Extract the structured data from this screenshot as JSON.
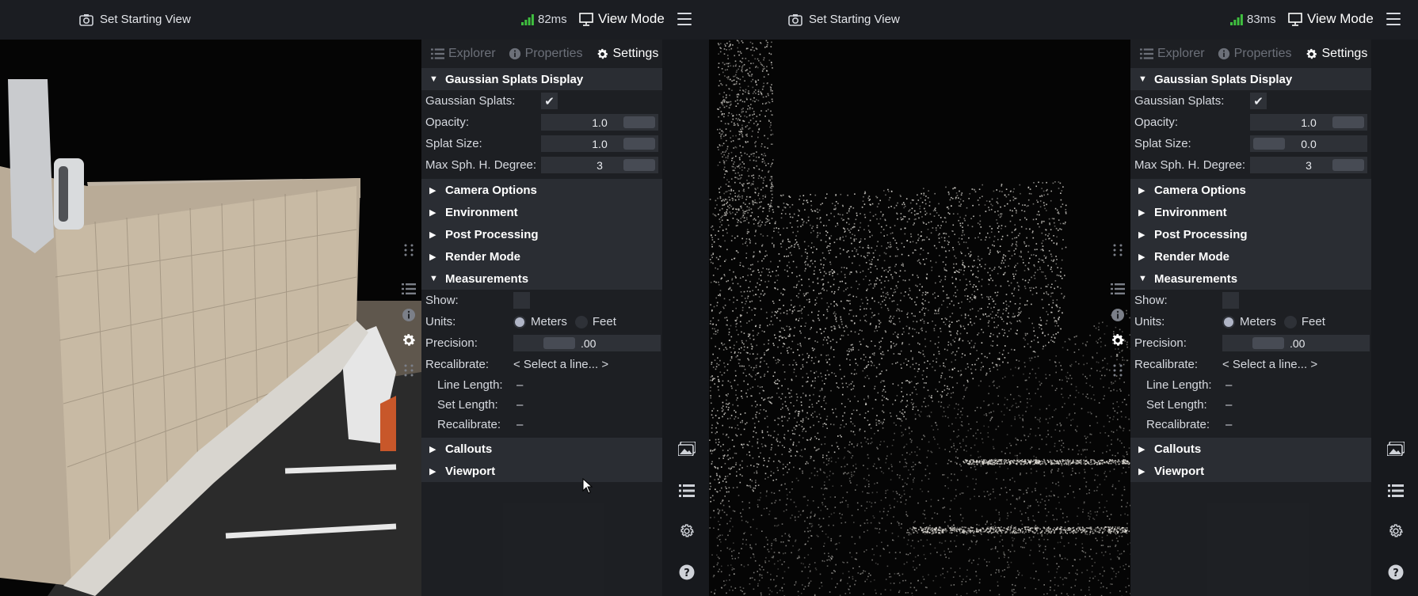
{
  "apps": [
    {
      "topbar": {
        "starting_view_label": "Set Starting View",
        "latency": "82ms",
        "view_mode_label": "View Mode"
      },
      "tabs": [
        {
          "label": "Explorer",
          "icon": "list-icon"
        },
        {
          "label": "Properties",
          "icon": "info-icon"
        },
        {
          "label": "Settings",
          "icon": "gear-icon"
        }
      ],
      "gaussian": {
        "title": "Gaussian Splats Display",
        "splats_label": "Gaussian Splats:",
        "opacity_label": "Opacity:",
        "opacity_value": "1.0",
        "splat_size_label": "Splat Size:",
        "splat_size_value": "1.0",
        "degree_label": "Max Sph. H. Degree:",
        "degree_value": "3"
      },
      "sections_collapsed": [
        "Camera Options",
        "Environment",
        "Post Processing",
        "Render Mode"
      ],
      "measurements": {
        "title": "Measurements",
        "show_label": "Show:",
        "units_label": "Units:",
        "meters": "Meters",
        "feet": "Feet",
        "precision_label": "Precision:",
        "precision_value": ".00",
        "recalibrate_label": "Recalibrate:",
        "recalibrate_value": "< Select a line... >",
        "line_length_label": "Line Length:",
        "line_length_value": "–",
        "set_length_label": "Set Length:",
        "set_length_value": "–",
        "recalibrate2_label": "Recalibrate:",
        "recalibrate2_value": "–"
      },
      "callouts": "Callouts",
      "viewport_section": "Viewport"
    },
    {
      "topbar": {
        "starting_view_label": "Set Starting View",
        "latency": "83ms",
        "view_mode_label": "View Mode"
      },
      "tabs": [
        {
          "label": "Explorer",
          "icon": "list-icon"
        },
        {
          "label": "Properties",
          "icon": "info-icon"
        },
        {
          "label": "Settings",
          "icon": "gear-icon"
        }
      ],
      "gaussian": {
        "title": "Gaussian Splats Display",
        "splats_label": "Gaussian Splats:",
        "opacity_label": "Opacity:",
        "opacity_value": "1.0",
        "splat_size_label": "Splat Size:",
        "splat_size_value": "0.0",
        "degree_label": "Max Sph. H. Degree:",
        "degree_value": "3"
      },
      "sections_collapsed": [
        "Camera Options",
        "Environment",
        "Post Processing",
        "Render Mode"
      ],
      "measurements": {
        "title": "Measurements",
        "show_label": "Show:",
        "units_label": "Units:",
        "meters": "Meters",
        "feet": "Feet",
        "precision_label": "Precision:",
        "precision_value": ".00",
        "recalibrate_label": "Recalibrate:",
        "recalibrate_value": "< Select a line... >",
        "line_length_label": "Line Length:",
        "line_length_value": "–",
        "set_length_label": "Set Length:",
        "set_length_value": "–",
        "recalibrate2_label": "Recalibrate:",
        "recalibrate2_value": "–"
      },
      "callouts": "Callouts",
      "viewport_section": "Viewport"
    }
  ],
  "colors": {
    "panel_bg": "#1e2024",
    "section_header": "#2a2d33",
    "field_bg": "#2e3137",
    "signal_green": "#3fbf3f"
  }
}
